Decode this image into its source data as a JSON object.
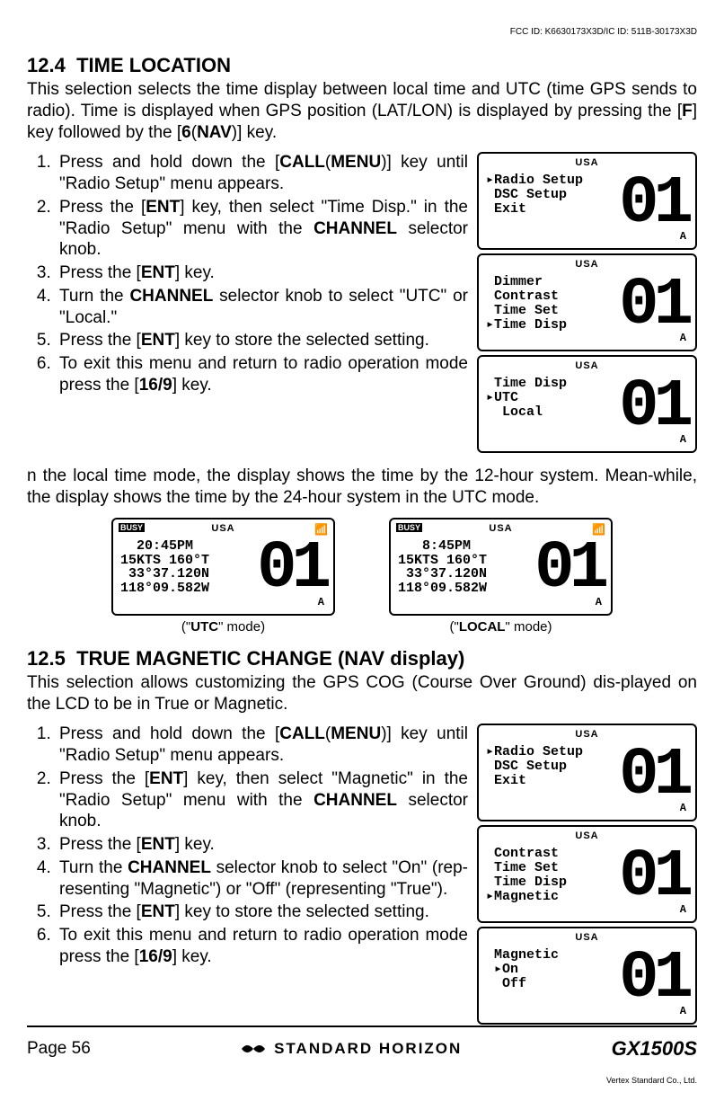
{
  "fcc_id": "FCC ID: K6630173X3D/IC ID: 511B-30173X3D",
  "s124": {
    "num": "12.4",
    "title": "TIME LOCATION",
    "intro_a": "This selection selects the time display between local time and UTC (time GPS sends to radio). Time is displayed when GPS position (LAT/LON) is displayed by pressing the [",
    "intro_b": "F",
    "intro_c": "] key followed by the [",
    "intro_d": "6",
    "intro_e": "(",
    "intro_f": "NAV",
    "intro_g": ")] key.",
    "step1a": "Press and hold down the [",
    "step1b": "CALL",
    "step1c": "(",
    "step1d": "MENU",
    "step1e": ")] key until \"",
    "step1f": "Radio Setup",
    "step1g": "\" menu appears.",
    "step2a": "Press the [",
    "step2b": "ENT",
    "step2c": "] key, then select \"",
    "step2d": "Time Disp.",
    "step2e": "\" in the \"",
    "step2f": "Radio Setup",
    "step2g": "\" menu with the ",
    "step2h": "CHANNEL",
    "step2i": " selector knob.",
    "step3a": "Press the [",
    "step3b": "ENT",
    "step3c": "] key.",
    "step4a": "Turn the ",
    "step4b": "CHANNEL",
    "step4c": " selector knob to select \"",
    "step4d": "UTC",
    "step4e": "\" or \"",
    "step4f": "Local",
    "step4g": ".\"",
    "step5a": "Press the [",
    "step5b": "ENT",
    "step5c": "] key to store  the selected setting.",
    "step6a": "To exit this menu and return to radio operation mode press the [",
    "step6b": "16/9",
    "step6c": "] key.",
    "lcd1": "▸Radio Setup\n DSC Setup\n Exit",
    "lcd2": " Dimmer\n Contrast\n Time Set\n▸Time Disp",
    "lcd3": " Time Disp\n▸UTC\n  Local",
    "big": "01",
    "sub": "A",
    "usa": "USA"
  },
  "note_p": "n the local time mode, the display shows the time by the 12-hour system. Mean-while, the display shows the time by the 24-hour system in the UTC mode.",
  "mode_utc": {
    "busy": "BUSY",
    "lines": "20:45PM\n15KTS 160°T\n 33°37.120N\n118°09.582W",
    "cap_a": "(\"",
    "cap_b": "UTC",
    "cap_c": "\" mode)"
  },
  "mode_local": {
    "busy": "BUSY",
    "lines": " 8:45PM\n15KTS 160°T\n 33°37.120N\n118°09.582W",
    "cap_a": "(\"",
    "cap_b": "LOCAL",
    "cap_c": "\" mode)"
  },
  "s125": {
    "num": "12.5",
    "title": "TRUE MAGNETIC CHANGE (NAV display)",
    "intro": "This selection allows customizing the GPS COG (Course Over Ground) dis-played on the LCD to be in True or Magnetic.",
    "step1a": "Press and hold down the [",
    "step1b": "CALL",
    "step1c": "(",
    "step1d": "MENU",
    "step1e": ")] key until \"",
    "step1f": "Radio Setup",
    "step1g": "\" menu appears.",
    "step2a": "Press the [",
    "step2b": "ENT",
    "step2c": "] key, then select \"",
    "step2d": "Magnetic",
    "step2e": "\" in the \"",
    "step2f": "Radio Setup",
    "step2g": "\" menu with the ",
    "step2h": "CHANNEL",
    "step2i": " selector knob.",
    "step3a": "Press the [",
    "step3b": "ENT",
    "step3c": "] key.",
    "step4a": "Turn the ",
    "step4b": "CHANNEL",
    "step4c": " selector knob to select \"",
    "step4d": "On",
    "step4e": "\" (rep-resenting \"Magnetic\") or \"",
    "step4f": "Off",
    "step4g": "\" (representing \"True\").",
    "step5a": "Press the [",
    "step5b": "ENT",
    "step5c": "] key to store the selected setting.",
    "step6a": "To exit this menu and return to radio operation mode press the [",
    "step6b": "16/9",
    "step6c": "] key.",
    "lcd1": "▸Radio Setup\n DSC Setup\n Exit",
    "lcd2": " Contrast\n Time Set\n Time Disp\n▸Magnetic",
    "lcd3": " Magnetic\n ▸On\n  Off"
  },
  "footer": {
    "page": "Page 56",
    "brand": "STANDARD HORIZON",
    "model": "GX1500S",
    "company": "Vertex Standard Co., Ltd."
  }
}
